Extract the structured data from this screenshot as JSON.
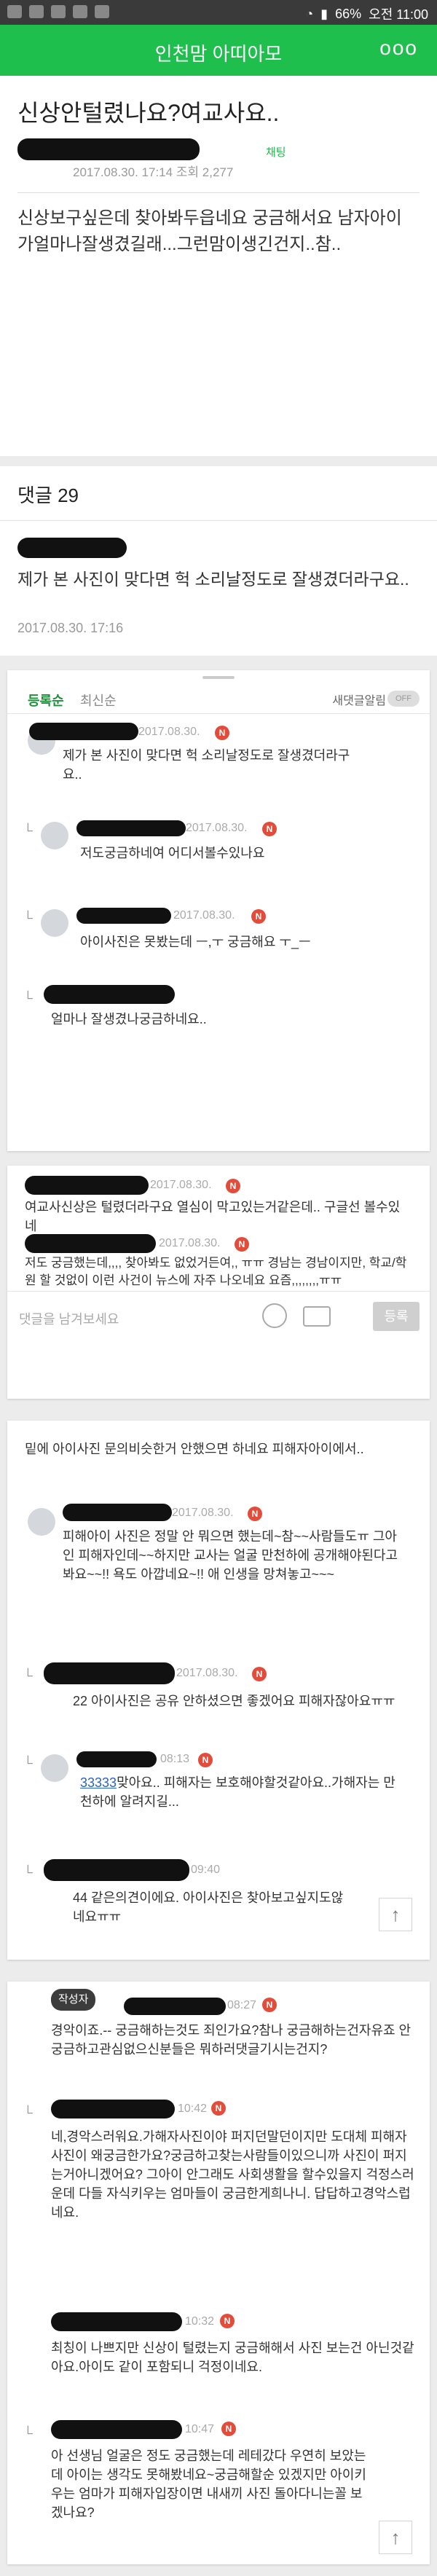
{
  "status_bar": {
    "left_icons": [
      "talk-icon",
      "sms-icon",
      "mail-icon",
      "photo-icon",
      "sound-icon"
    ],
    "battery": "66%",
    "time": "오전 11:00"
  },
  "appbar": {
    "title": "인천맘 아띠아모",
    "more": "ooo"
  },
  "post": {
    "title": "신상안털렸나요?여교사요..",
    "meta": "2017.08.30. 17:14   조회 2,277",
    "chat_badge": "채팅",
    "body": "신상보구싶은데 찾아봐두읍네요 궁금해서요 남자아이가얼마나잘생겼길래...그런맘이생긴건지..참.."
  },
  "comments_header": {
    "count_label": "댓글 29",
    "preview_text": "제가 본 사진이 맞다면 헉 소리날정도로 잘생겼더라구요..",
    "preview_date": "2017.08.30. 17:16"
  },
  "panel1": {
    "tab_active": "등록순",
    "tab_normal": "최신순",
    "notif": "새댓글알림",
    "toggle": "OFF",
    "c1_date": "2017.08.30.",
    "c1_text": "제가 본 사진이 맞다면 헉 소리날정도로 잘생겼더라구요..",
    "c2_date": "2017.08.30.",
    "c2_text": "저도궁금하네여 어디서볼수있나요",
    "c3_date": "2017.08.30.",
    "c3_text": "아이사진은 못봤는데 ㅡ,ㅜ 궁금해요 ㅜ_ㅡ",
    "c4_text": "얼마나 잘생겼나궁금하네요..",
    "badge": "N"
  },
  "panel2": {
    "c1_date": "2017.08.30.",
    "c1_text": "여교사신상은 털렸더라구요 열심이 막고있는거같은데.. 구글선 볼수있네",
    "c2_date": "2017.08.30.",
    "c2_text": "저도 궁금했는데,,,, 찾아봐도 없었거든여,, ㅠㅠ 경남는 경남이지만, 학교/학원 할 것없이 이런 사건이 뉴스에 자주 나오네요 요즘,,,,,,,,ㅠㅠ",
    "input_placeholder": "댓글을 남겨보세요",
    "register": "등록",
    "badge": "N"
  },
  "panel3": {
    "c0_text": "밑에 아이사진 문의비슷한거 안했으면 하네요 피해자아이에서..",
    "c1_date": "2017.08.30.",
    "c1_text": "피해아이 사진은 정말 안 뭐으면 했는데~참~~사람들도ㅠ 그아인 피해자인데~~하지만 교사는 얼굴 만천하에 공개해야된다고봐요~~!! 욕도 아깝네요~!! 애 인생을 망쳐놓고~~~",
    "c2_date": "2017.08.30.",
    "c2_text": "22 아이사진은 공유 안하셨으면 좋겠어요 피해자잖아요ㅠㅠ",
    "c3_date": "08:13",
    "c3_link": "33333",
    "c3_text": "맞아요.. 피해자는 보호해야할것같아요..가해자는 만천하에 알려지길...",
    "c4_date": "09:40",
    "c4_text": "44 같은의견이에요. 아이사진은 찾아보고싶지도않네요ㅠㅠ",
    "badge": "N",
    "to_top": "↑"
  },
  "panel4": {
    "writer_badge": "작성자",
    "c1_date": "08:27",
    "c1_text": "경악이죠.-- 궁금해하는것도 죄인가요?참나 궁금해하는건자유죠 안궁금하고관심없으신분들은 뭐하러댓글기시는건지?",
    "c2_date": "10:42",
    "c2_text": "네,경악스러워요.가해자사진이야 퍼지던말던이지만 도대체 피해자사진이 왜궁금한가요?궁금하고찾는사람들이있으니까 사진이 퍼지는거아니겠어요? 그아이 안그래도 사회생활을 할수있을지 걱정스러운데 다들 자식키우는 엄마들이 궁금한게희나니. 답답하고경악스럽네요.",
    "c3_date": "10:32",
    "c3_text": "최칭이 나쁘지만 신상이 털렸는지 궁금해해서 사진 보는건 아닌것같아요.아이도 같이 포함되니 걱정이네요.",
    "c4_date": "10:47",
    "c4_text": "아 선생님 얼굴은 정도 궁금했는데 레테갔다 우연히 보았는데 아이는 생각도 못해봤네요~궁금해할순 있겠지만 아이키우는 엄마가 피해자입장이면 내새끼 사진 돌아다니는꼴 보겠나요?",
    "badge": "N",
    "to_top": "↑"
  }
}
